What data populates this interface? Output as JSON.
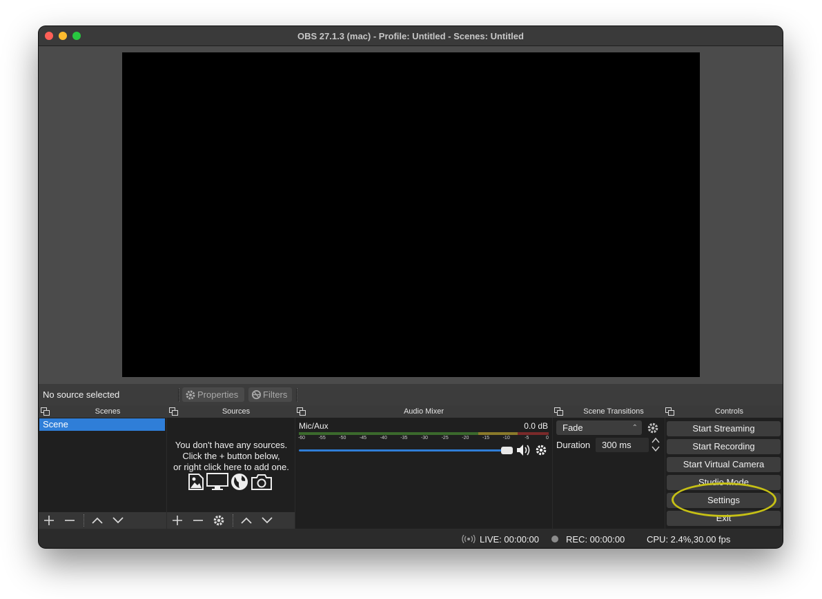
{
  "window": {
    "title": "OBS 27.1.3 (mac) - Profile: Untitled - Scenes: Untitled"
  },
  "source_bar": {
    "no_source": "No source selected",
    "properties": "Properties",
    "filters": "Filters"
  },
  "docks": {
    "scenes": "Scenes",
    "sources": "Sources",
    "audio_mixer": "Audio Mixer",
    "scene_transitions": "Scene Transitions",
    "controls": "Controls"
  },
  "scenes": {
    "items": [
      "Scene"
    ]
  },
  "sources": {
    "empty_line1": "You don't have any sources.",
    "empty_line2": "Click the + button below,",
    "empty_line3": "or right click here to add one."
  },
  "mixer": {
    "channel": "Mic/Aux",
    "level": "0.0 dB",
    "ticks": [
      "-60",
      "-55",
      "-50",
      "-45",
      "-40",
      "-35",
      "-30",
      "-25",
      "-20",
      "-15",
      "-10",
      "-5",
      "0"
    ],
    "volume_fraction": 0.97
  },
  "transitions": {
    "selected": "Fade",
    "duration_label": "Duration",
    "duration_value": "300 ms"
  },
  "controls": {
    "start_streaming": "Start Streaming",
    "start_recording": "Start Recording",
    "start_virtual_camera": "Start Virtual Camera",
    "studio_mode": "Studio Mode",
    "settings": "Settings",
    "exit": "Exit"
  },
  "status": {
    "live": "LIVE: 00:00:00",
    "rec": "REC: 00:00:00",
    "cpu": "CPU: 2.4%,30.00 fps"
  },
  "colors": {
    "accent": "#2f7ed8",
    "highlight": "#c6c015"
  }
}
